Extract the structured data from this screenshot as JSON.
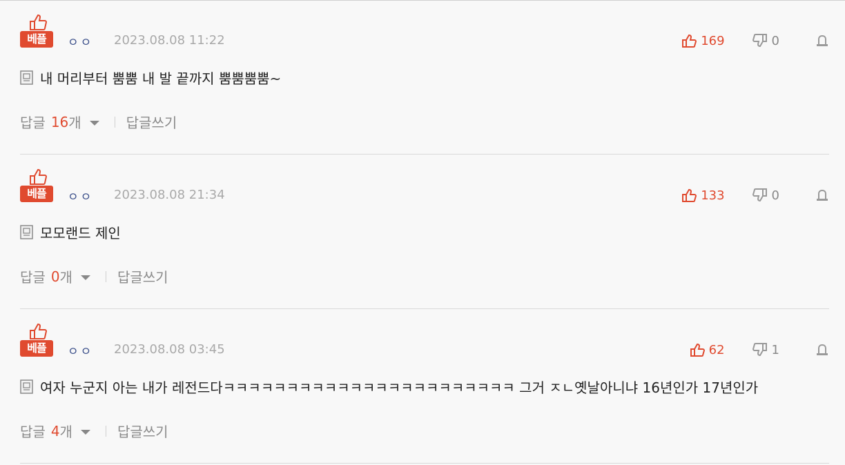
{
  "colors": {
    "accent": "#e04a2f",
    "muted": "#8a8a8a",
    "user": "#3b4f8a"
  },
  "comments": [
    {
      "badge": "베플",
      "user": "ㅇㅇ",
      "date": "2023.08.08 11:22",
      "likes": "169",
      "dislikes": "0",
      "text": "내 머리부터 뿜뿜 내 발 끝까지 뿜뿜뿜뿜~",
      "reply_label": "답글",
      "reply_count": "16",
      "reply_unit": "개",
      "write_label": "답글쓰기"
    },
    {
      "badge": "베플",
      "user": "ㅇㅇ",
      "date": "2023.08.08 21:34",
      "likes": "133",
      "dislikes": "0",
      "text": "모모랜드 제인",
      "reply_label": "답글",
      "reply_count": "0",
      "reply_unit": "개",
      "write_label": "답글쓰기"
    },
    {
      "badge": "베플",
      "user": "ㅇㅇ",
      "date": "2023.08.08 03:45",
      "likes": "62",
      "dislikes": "1",
      "text": "여자 누군지 아는 내가 레전드다ㅋㅋㅋㅋㅋㅋㅋㅋㅋㅋㅋㅋㅋㅋㅋㅋㅋㅋㅋㅋㅋㅋㅋ 그거 ㅈㄴ옛날아니냐 16년인가 17년인가",
      "reply_label": "답글",
      "reply_count": "4",
      "reply_unit": "개",
      "write_label": "답글쓰기"
    }
  ]
}
